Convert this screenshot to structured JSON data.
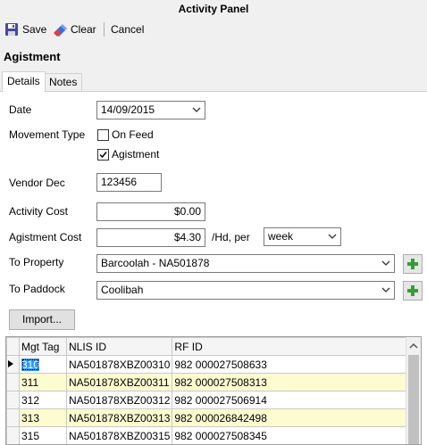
{
  "window": {
    "title": "Activity Panel"
  },
  "toolbar": {
    "save_label": "Save",
    "clear_label": "Clear",
    "cancel_label": "Cancel"
  },
  "panel": {
    "title": "Agistment"
  },
  "tabs": [
    {
      "label": "Details",
      "active": true
    },
    {
      "label": "Notes",
      "active": false
    }
  ],
  "form": {
    "date_label": "Date",
    "date_value": "14/09/2015",
    "movement_type_label": "Movement Type",
    "on_feed_label": "On Feed",
    "on_feed_checked": false,
    "agistment_label": "Agistment",
    "agistment_checked": true,
    "vendor_dec_label": "Vendor Dec",
    "vendor_dec_value": "123456",
    "activity_cost_label": "Activity Cost",
    "activity_cost_value": "$0.00",
    "agistment_cost_label": "Agistment Cost",
    "agistment_cost_value": "$4.30",
    "per_label": "/Hd, per",
    "period_value": "week",
    "to_property_label": "To Property",
    "to_property_value": "Barcoolah - NA501878",
    "to_paddock_label": "To Paddock",
    "to_paddock_value": "Coolibah",
    "import_label": "Import..."
  },
  "grid": {
    "columns": [
      "Mgt Tag",
      "NLIS ID",
      "RF ID"
    ],
    "rows": [
      {
        "mgt_tag": "310",
        "nlis_id": "NA501878XBZ00310",
        "rf_id": "982 000027508633",
        "highlight": false,
        "current": true
      },
      {
        "mgt_tag": "311",
        "nlis_id": "NA501878XBZ00311",
        "rf_id": "982 000027508313",
        "highlight": true,
        "current": false
      },
      {
        "mgt_tag": "312",
        "nlis_id": "NA501878XBZ00312",
        "rf_id": "982 000027506914",
        "highlight": false,
        "current": false
      },
      {
        "mgt_tag": "313",
        "nlis_id": "NA501878XBZ00313",
        "rf_id": "982 000026842498",
        "highlight": true,
        "current": false
      },
      {
        "mgt_tag": "315",
        "nlis_id": "NA501878XBZ00315",
        "rf_id": "982 000027508345",
        "highlight": false,
        "current": false
      }
    ]
  },
  "icons": {
    "save": "floppy-disk-icon",
    "clear": "eraser-icon",
    "add": "plus-icon"
  },
  "colors": {
    "highlight_row": "#fdfbd0",
    "selection": "#3399ff",
    "plus": "#3a9a3a"
  }
}
